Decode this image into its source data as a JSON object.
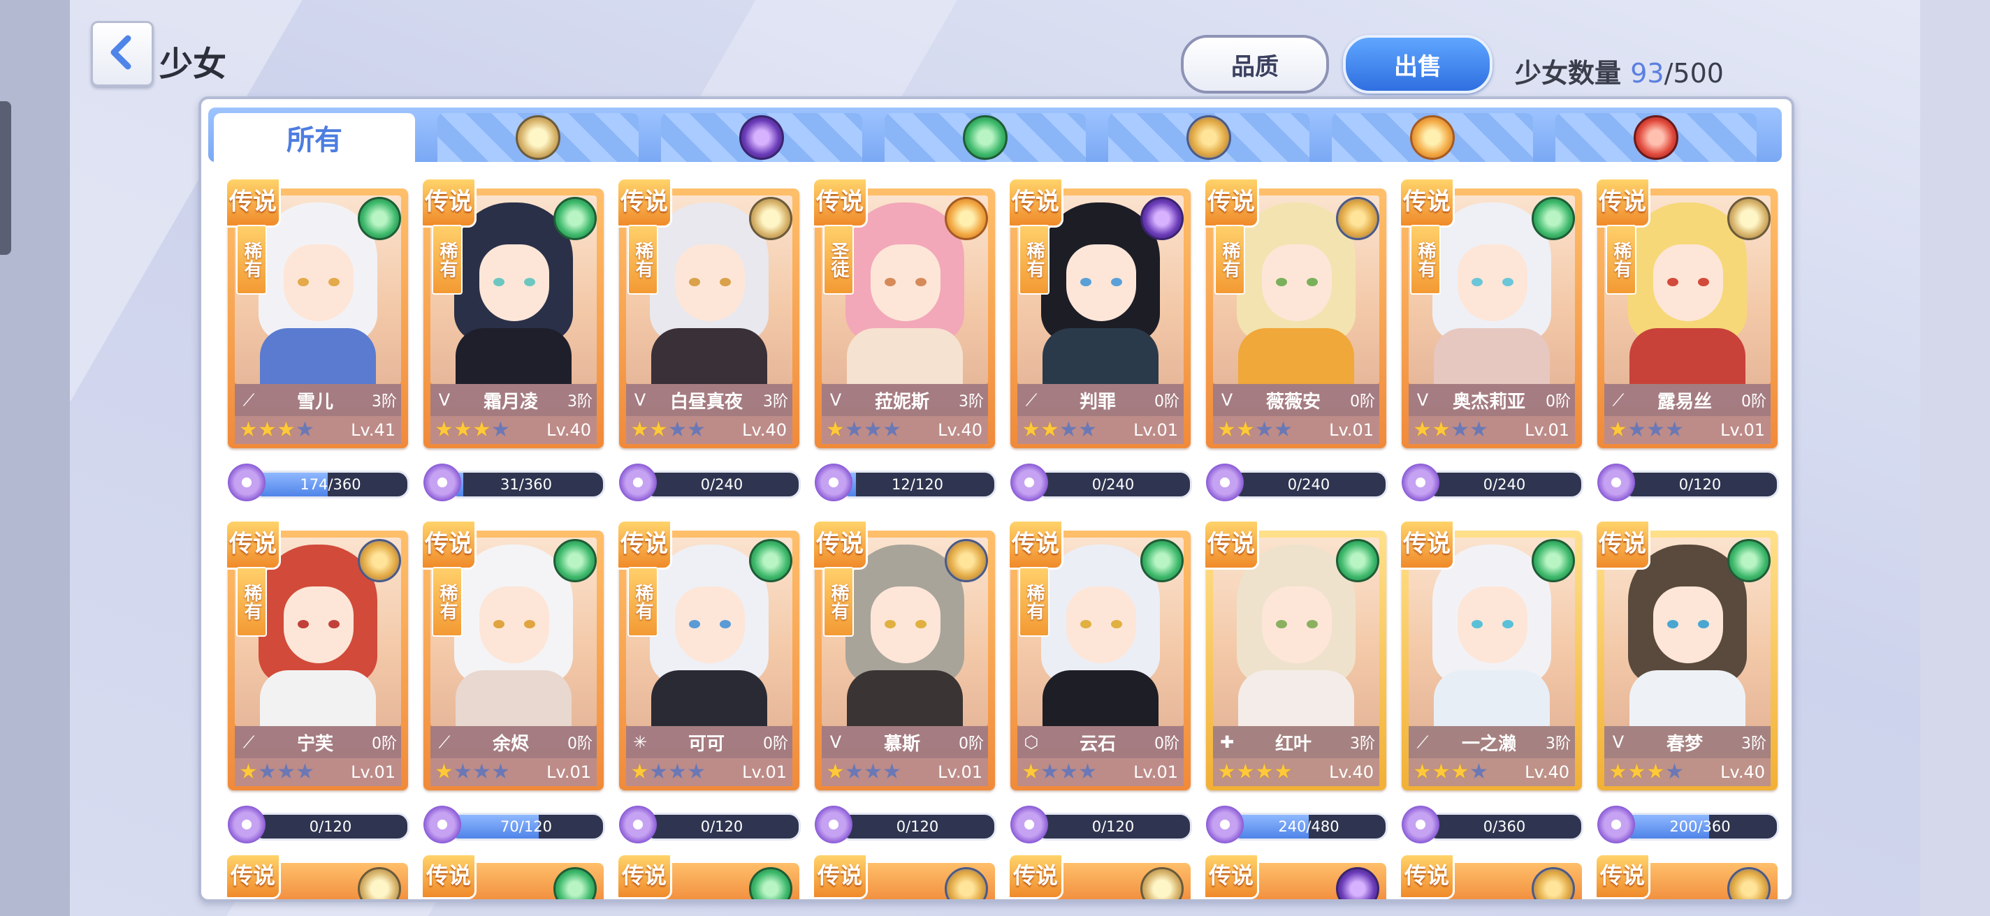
{
  "header": {
    "title": "少女",
    "quality_label": "品质",
    "sell_label": "出售",
    "count_label": "少女数量",
    "count_current": "93",
    "count_max": "/500"
  },
  "tabs": [
    {
      "label": "所有",
      "element": "all"
    },
    {
      "label": "",
      "element": "light-icon"
    },
    {
      "label": "",
      "element": "dark-icon"
    },
    {
      "label": "",
      "element": "wind-icon"
    },
    {
      "label": "",
      "element": "earth-icon"
    },
    {
      "label": "",
      "element": "sun-icon"
    },
    {
      "label": "",
      "element": "fire-icon"
    }
  ],
  "card_common": {
    "legend_badge": "传说"
  },
  "cards": [
    {
      "name": "雪儿",
      "tier": "3阶",
      "rarity": "稀有",
      "element": "wind",
      "class_icon": "⟋",
      "stars": 3,
      "level": "Lv.41",
      "xp": "174/360",
      "xp_ratio": 0.48,
      "hair": "#f2f2f6",
      "body": "#5a7bd0",
      "eye": "#e3a94a"
    },
    {
      "name": "霜月凌",
      "tier": "3阶",
      "rarity": "稀有",
      "element": "wind",
      "class_icon": "V",
      "stars": 3,
      "level": "Lv.40",
      "xp": "31/360",
      "xp_ratio": 0.09,
      "hair": "#2a3048",
      "body": "#1e1f2a",
      "eye": "#6dc7c0"
    },
    {
      "name": "白昼真夜",
      "tier": "3阶",
      "rarity": "稀有",
      "element": "light",
      "class_icon": "V",
      "stars": 2,
      "level": "Lv.40",
      "xp": "0/240",
      "xp_ratio": 0,
      "hair": "#e8e8ee",
      "body": "#3a3038",
      "eye": "#d9a14a"
    },
    {
      "name": "菈妮斯",
      "tier": "3阶",
      "rarity": "圣徒",
      "element": "sun",
      "class_icon": "V",
      "stars": 1,
      "level": "Lv.40",
      "xp": "12/120",
      "xp_ratio": 0.1,
      "hair": "#f2a8b8",
      "body": "#f6e2d0",
      "eye": "#d68a5a"
    },
    {
      "name": "判罪",
      "tier": "0阶",
      "rarity": "稀有",
      "element": "dark",
      "class_icon": "⟋",
      "stars": 2,
      "level": "Lv.01",
      "xp": "0/240",
      "xp_ratio": 0,
      "hair": "#1d1d26",
      "body": "#2a3a4a",
      "eye": "#5aa0d8"
    },
    {
      "name": "薇薇安",
      "tier": "0阶",
      "rarity": "稀有",
      "element": "earth",
      "class_icon": "V",
      "stars": 2,
      "level": "Lv.01",
      "xp": "0/240",
      "xp_ratio": 0,
      "hair": "#f3e3b0",
      "body": "#f0a83a",
      "eye": "#7ab05a"
    },
    {
      "name": "奥杰莉亚",
      "tier": "0阶",
      "rarity": "稀有",
      "element": "wind",
      "class_icon": "V",
      "stars": 2,
      "level": "Lv.01",
      "xp": "0/240",
      "xp_ratio": 0,
      "hair": "#eef0f6",
      "body": "#e6c8c0",
      "eye": "#6ac6d8"
    },
    {
      "name": "露易丝",
      "tier": "0阶",
      "rarity": "稀有",
      "element": "light",
      "class_icon": "⟋",
      "stars": 1,
      "level": "Lv.01",
      "xp": "0/120",
      "xp_ratio": 0,
      "hair": "#f6d878",
      "body": "#c8423a",
      "eye": "#d24a3a"
    },
    {
      "name": "宁芙",
      "tier": "0阶",
      "rarity": "稀有",
      "element": "earth",
      "class_icon": "⟋",
      "stars": 1,
      "level": "Lv.01",
      "xp": "0/120",
      "xp_ratio": 0,
      "hair": "#d24a3a",
      "body": "#f2f2f2",
      "eye": "#c2403a"
    },
    {
      "name": "余烬",
      "tier": "0阶",
      "rarity": "稀有",
      "element": "wind",
      "class_icon": "⟋",
      "stars": 1,
      "level": "Lv.01",
      "xp": "70/120",
      "xp_ratio": 0.58,
      "hair": "#f4f4f6",
      "body": "#e8d8d0",
      "eye": "#e0a440"
    },
    {
      "name": "可可",
      "tier": "0阶",
      "rarity": "稀有",
      "element": "wind",
      "class_icon": "✳",
      "stars": 1,
      "level": "Lv.01",
      "xp": "0/120",
      "xp_ratio": 0,
      "hair": "#eef0f6",
      "body": "#2a2a34",
      "eye": "#5a9ad6"
    },
    {
      "name": "慕斯",
      "tier": "0阶",
      "rarity": "稀有",
      "element": "earth",
      "class_icon": "V",
      "stars": 1,
      "level": "Lv.01",
      "xp": "0/120",
      "xp_ratio": 0,
      "hair": "#a8a49a",
      "body": "#3a3434",
      "eye": "#e0b040"
    },
    {
      "name": "云石",
      "tier": "0阶",
      "rarity": "稀有",
      "element": "wind",
      "class_icon": "⬡",
      "stars": 1,
      "level": "Lv.01",
      "xp": "0/120",
      "xp_ratio": 0,
      "hair": "#eceef6",
      "body": "#1e1e26",
      "eye": "#e0b040"
    },
    {
      "name": "红叶",
      "tier": "3阶",
      "rarity": "",
      "element": "wind",
      "class_icon": "✚",
      "stars": 4,
      "level": "Lv.40",
      "xp": "240/480",
      "xp_ratio": 0.5,
      "hair": "#efe2cc",
      "body": "#f4ece8",
      "eye": "#8ab060"
    },
    {
      "name": "一之濑",
      "tier": "3阶",
      "rarity": "",
      "element": "wind",
      "class_icon": "⟋",
      "stars": 3,
      "level": "Lv.40",
      "xp": "0/360",
      "xp_ratio": 0,
      "hair": "#f2f2f6",
      "body": "#e8eef6",
      "eye": "#5ac0d8"
    },
    {
      "name": "春梦",
      "tier": "3阶",
      "rarity": "",
      "element": "wind",
      "class_icon": "V",
      "stars": 3,
      "level": "Lv.40",
      "xp": "200/360",
      "xp_ratio": 0.56,
      "hair": "#5a4a3e",
      "body": "#eef2f6",
      "eye": "#4aa6d0"
    }
  ],
  "peek_row": [
    "light",
    "wind",
    "wind",
    "earth",
    "light",
    "dark",
    "earth",
    "earth"
  ]
}
